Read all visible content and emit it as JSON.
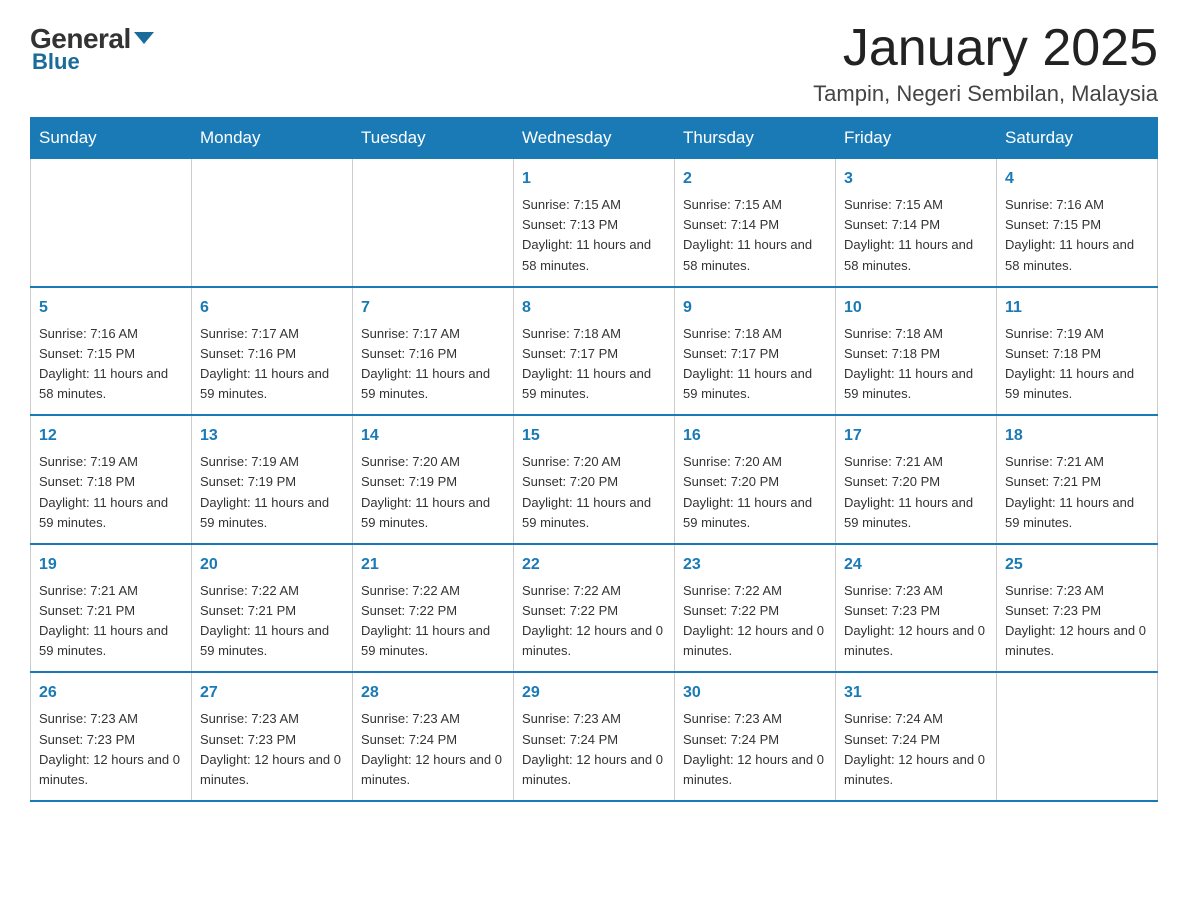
{
  "header": {
    "logo_general": "General",
    "logo_blue": "Blue",
    "title": "January 2025",
    "subtitle": "Tampin, Negeri Sembilan, Malaysia"
  },
  "days_of_week": [
    "Sunday",
    "Monday",
    "Tuesday",
    "Wednesday",
    "Thursday",
    "Friday",
    "Saturday"
  ],
  "weeks": [
    [
      {
        "num": "",
        "info": ""
      },
      {
        "num": "",
        "info": ""
      },
      {
        "num": "",
        "info": ""
      },
      {
        "num": "1",
        "info": "Sunrise: 7:15 AM\nSunset: 7:13 PM\nDaylight: 11 hours and 58 minutes."
      },
      {
        "num": "2",
        "info": "Sunrise: 7:15 AM\nSunset: 7:14 PM\nDaylight: 11 hours and 58 minutes."
      },
      {
        "num": "3",
        "info": "Sunrise: 7:15 AM\nSunset: 7:14 PM\nDaylight: 11 hours and 58 minutes."
      },
      {
        "num": "4",
        "info": "Sunrise: 7:16 AM\nSunset: 7:15 PM\nDaylight: 11 hours and 58 minutes."
      }
    ],
    [
      {
        "num": "5",
        "info": "Sunrise: 7:16 AM\nSunset: 7:15 PM\nDaylight: 11 hours and 58 minutes."
      },
      {
        "num": "6",
        "info": "Sunrise: 7:17 AM\nSunset: 7:16 PM\nDaylight: 11 hours and 59 minutes."
      },
      {
        "num": "7",
        "info": "Sunrise: 7:17 AM\nSunset: 7:16 PM\nDaylight: 11 hours and 59 minutes."
      },
      {
        "num": "8",
        "info": "Sunrise: 7:18 AM\nSunset: 7:17 PM\nDaylight: 11 hours and 59 minutes."
      },
      {
        "num": "9",
        "info": "Sunrise: 7:18 AM\nSunset: 7:17 PM\nDaylight: 11 hours and 59 minutes."
      },
      {
        "num": "10",
        "info": "Sunrise: 7:18 AM\nSunset: 7:18 PM\nDaylight: 11 hours and 59 minutes."
      },
      {
        "num": "11",
        "info": "Sunrise: 7:19 AM\nSunset: 7:18 PM\nDaylight: 11 hours and 59 minutes."
      }
    ],
    [
      {
        "num": "12",
        "info": "Sunrise: 7:19 AM\nSunset: 7:18 PM\nDaylight: 11 hours and 59 minutes."
      },
      {
        "num": "13",
        "info": "Sunrise: 7:19 AM\nSunset: 7:19 PM\nDaylight: 11 hours and 59 minutes."
      },
      {
        "num": "14",
        "info": "Sunrise: 7:20 AM\nSunset: 7:19 PM\nDaylight: 11 hours and 59 minutes."
      },
      {
        "num": "15",
        "info": "Sunrise: 7:20 AM\nSunset: 7:20 PM\nDaylight: 11 hours and 59 minutes."
      },
      {
        "num": "16",
        "info": "Sunrise: 7:20 AM\nSunset: 7:20 PM\nDaylight: 11 hours and 59 minutes."
      },
      {
        "num": "17",
        "info": "Sunrise: 7:21 AM\nSunset: 7:20 PM\nDaylight: 11 hours and 59 minutes."
      },
      {
        "num": "18",
        "info": "Sunrise: 7:21 AM\nSunset: 7:21 PM\nDaylight: 11 hours and 59 minutes."
      }
    ],
    [
      {
        "num": "19",
        "info": "Sunrise: 7:21 AM\nSunset: 7:21 PM\nDaylight: 11 hours and 59 minutes."
      },
      {
        "num": "20",
        "info": "Sunrise: 7:22 AM\nSunset: 7:21 PM\nDaylight: 11 hours and 59 minutes."
      },
      {
        "num": "21",
        "info": "Sunrise: 7:22 AM\nSunset: 7:22 PM\nDaylight: 11 hours and 59 minutes."
      },
      {
        "num": "22",
        "info": "Sunrise: 7:22 AM\nSunset: 7:22 PM\nDaylight: 12 hours and 0 minutes."
      },
      {
        "num": "23",
        "info": "Sunrise: 7:22 AM\nSunset: 7:22 PM\nDaylight: 12 hours and 0 minutes."
      },
      {
        "num": "24",
        "info": "Sunrise: 7:23 AM\nSunset: 7:23 PM\nDaylight: 12 hours and 0 minutes."
      },
      {
        "num": "25",
        "info": "Sunrise: 7:23 AM\nSunset: 7:23 PM\nDaylight: 12 hours and 0 minutes."
      }
    ],
    [
      {
        "num": "26",
        "info": "Sunrise: 7:23 AM\nSunset: 7:23 PM\nDaylight: 12 hours and 0 minutes."
      },
      {
        "num": "27",
        "info": "Sunrise: 7:23 AM\nSunset: 7:23 PM\nDaylight: 12 hours and 0 minutes."
      },
      {
        "num": "28",
        "info": "Sunrise: 7:23 AM\nSunset: 7:24 PM\nDaylight: 12 hours and 0 minutes."
      },
      {
        "num": "29",
        "info": "Sunrise: 7:23 AM\nSunset: 7:24 PM\nDaylight: 12 hours and 0 minutes."
      },
      {
        "num": "30",
        "info": "Sunrise: 7:23 AM\nSunset: 7:24 PM\nDaylight: 12 hours and 0 minutes."
      },
      {
        "num": "31",
        "info": "Sunrise: 7:24 AM\nSunset: 7:24 PM\nDaylight: 12 hours and 0 minutes."
      },
      {
        "num": "",
        "info": ""
      }
    ]
  ]
}
